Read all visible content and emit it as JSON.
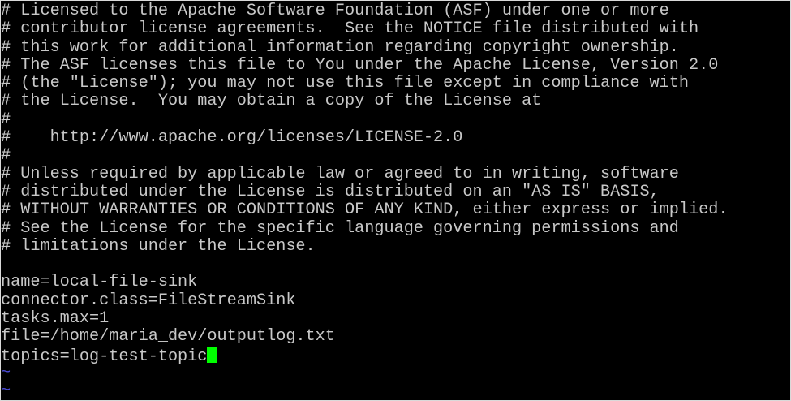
{
  "editor": {
    "cursor_color": "#00ff00",
    "text_color": "#c8c8c8",
    "tilde_color": "#4a4ad8",
    "background_color": "#000000"
  },
  "buffer": {
    "lines": [
      "# Licensed to the Apache Software Foundation (ASF) under one or more",
      "# contributor license agreements.  See the NOTICE file distributed with",
      "# this work for additional information regarding copyright ownership.",
      "# The ASF licenses this file to You under the Apache License, Version 2.0",
      "# (the \"License\"); you may not use this file except in compliance with",
      "# the License.  You may obtain a copy of the License at",
      "#",
      "#    http://www.apache.org/licenses/LICENSE-2.0",
      "#",
      "# Unless required by applicable law or agreed to in writing, software",
      "# distributed under the License is distributed on an \"AS IS\" BASIS,",
      "# WITHOUT WARRANTIES OR CONDITIONS OF ANY KIND, either express or implied.",
      "# See the License for the specific language governing permissions and",
      "# limitations under the License.",
      "",
      "name=local-file-sink",
      "connector.class=FileStreamSink",
      "tasks.max=1",
      "file=/home/maria_dev/outputlog.txt",
      "topics=log-test-topic"
    ],
    "empty_line_markers": [
      "~",
      "~"
    ]
  }
}
